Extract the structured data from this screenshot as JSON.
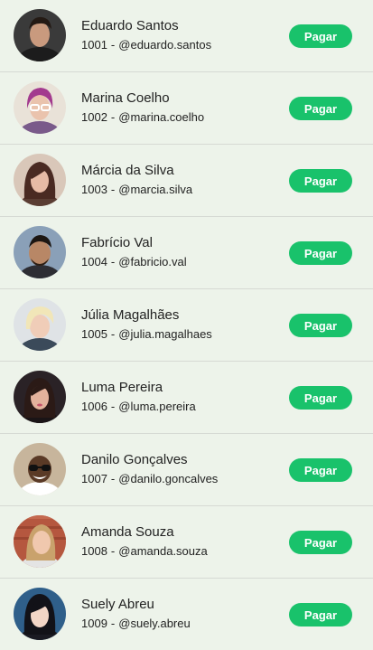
{
  "accent_color": "#19c26b",
  "background_color": "#edf3ea",
  "users": [
    {
      "name": "Eduardo Santos",
      "id": "1001",
      "username": "@eduardo.santos",
      "button_label": "Pagar",
      "avatar_icon": "user-photo-icon"
    },
    {
      "name": "Marina Coelho",
      "id": "1002",
      "username": "@marina.coelho",
      "button_label": "Pagar",
      "avatar_icon": "user-photo-icon"
    },
    {
      "name": "Márcia da Silva",
      "id": "1003",
      "username": "@marcia.silva",
      "button_label": "Pagar",
      "avatar_icon": "user-photo-icon"
    },
    {
      "name": "Fabrício Val",
      "id": "1004",
      "username": "@fabricio.val",
      "button_label": "Pagar",
      "avatar_icon": "user-photo-icon"
    },
    {
      "name": "Júlia Magalhães",
      "id": "1005",
      "username": "@julia.magalhaes",
      "button_label": "Pagar",
      "avatar_icon": "user-photo-icon"
    },
    {
      "name": "Luma Pereira",
      "id": "1006",
      "username": "@luma.pereira",
      "button_label": "Pagar",
      "avatar_icon": "user-photo-icon"
    },
    {
      "name": "Danilo Gonçalves",
      "id": "1007",
      "username": "@danilo.goncalves",
      "button_label": "Pagar",
      "avatar_icon": "user-photo-icon"
    },
    {
      "name": "Amanda Souza",
      "id": "1008",
      "username": "@amanda.souza",
      "button_label": "Pagar",
      "avatar_icon": "user-photo-icon"
    },
    {
      "name": "Suely Abreu",
      "id": "1009",
      "username": "@suely.abreu",
      "button_label": "Pagar",
      "avatar_icon": "user-photo-icon"
    }
  ]
}
